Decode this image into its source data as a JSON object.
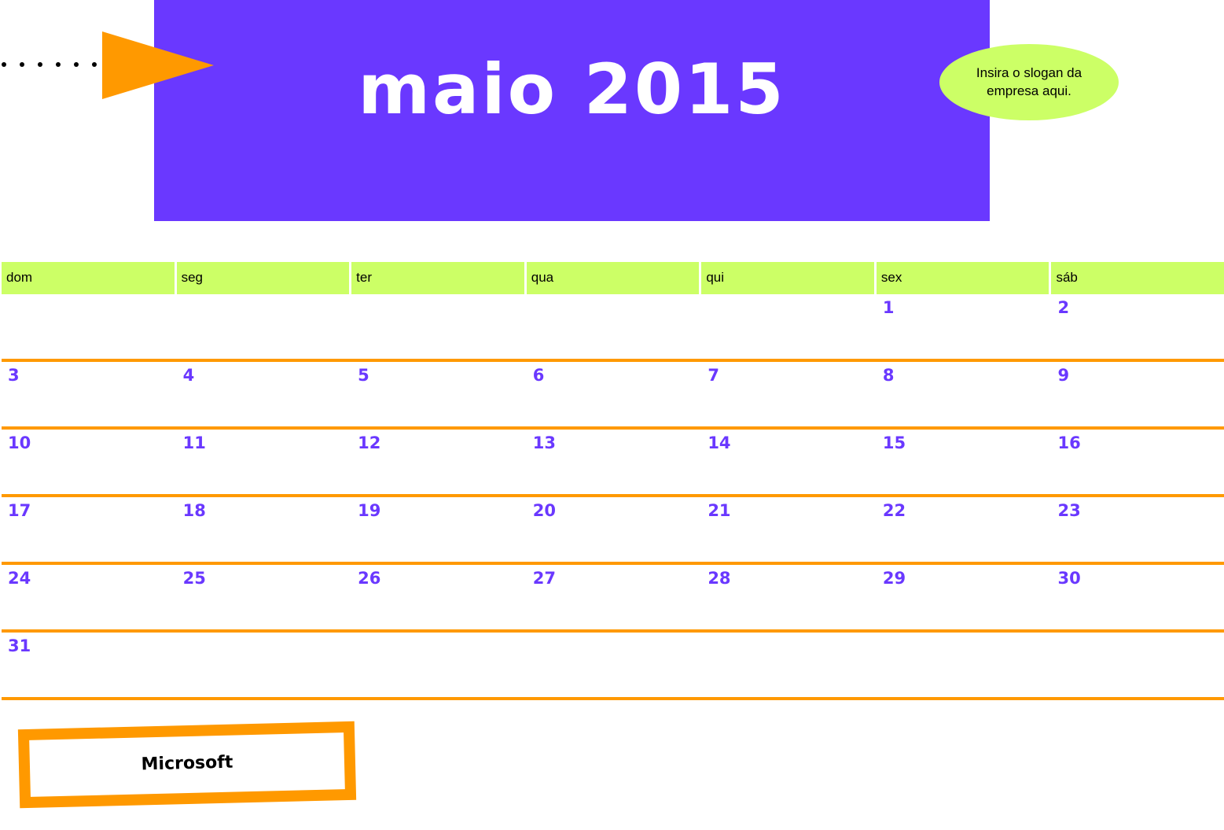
{
  "title": "maio 2015",
  "slogan": "Insira o slogan da empresa aqui.",
  "logo_text": "Microsoft",
  "colors": {
    "title_band": "#6a38ff",
    "accent_orange": "#ff9900",
    "accent_green": "#ccff66",
    "day_number": "#6a38ff"
  },
  "weekdays": [
    "dom",
    "seg",
    "ter",
    "qua",
    "qui",
    "sex",
    "sáb"
  ],
  "weeks": [
    [
      "",
      "",
      "",
      "",
      "",
      "1",
      "2"
    ],
    [
      "3",
      "4",
      "5",
      "6",
      "7",
      "8",
      "9"
    ],
    [
      "10",
      "11",
      "12",
      "13",
      "14",
      "15",
      "16"
    ],
    [
      "17",
      "18",
      "19",
      "20",
      "21",
      "22",
      "23"
    ],
    [
      "24",
      "25",
      "26",
      "27",
      "28",
      "29",
      "30"
    ],
    [
      "31",
      "",
      "",
      "",
      "",
      "",
      ""
    ]
  ]
}
